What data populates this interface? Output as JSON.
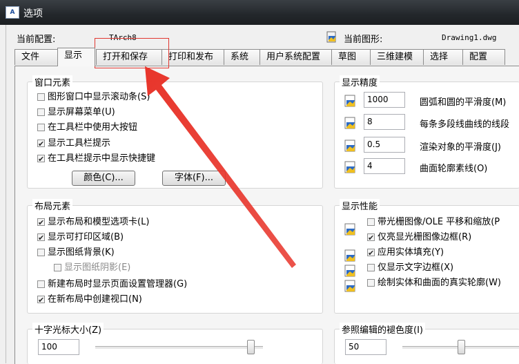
{
  "window": {
    "title": "选项",
    "app_icon_text": "A"
  },
  "profile": {
    "current_config_label": "当前配置:",
    "current_config_value": "TArch8",
    "current_drawing_label": "当前图形:",
    "current_drawing_value": "Drawing1.dwg"
  },
  "tabs": [
    {
      "label": "文件"
    },
    {
      "label": "显示"
    },
    {
      "label": "打开和保存"
    },
    {
      "label": "打印和发布"
    },
    {
      "label": "系统"
    },
    {
      "label": "用户系统配置"
    },
    {
      "label": "草图"
    },
    {
      "label": "三维建模"
    },
    {
      "label": "选择"
    },
    {
      "label": "配置"
    }
  ],
  "window_elements": {
    "title": "窗口元素",
    "checkboxes": [
      {
        "label": "图形窗口中显示滚动条(S)",
        "checked": false
      },
      {
        "label": "显示屏幕菜单(U)",
        "checked": false
      },
      {
        "label": "在工具栏中使用大按钮",
        "checked": false
      },
      {
        "label": "显示工具栏提示",
        "checked": true
      },
      {
        "label": "在工具栏提示中显示快捷键",
        "checked": true
      }
    ],
    "colors_button": "颜色(C)...",
    "fonts_button": "字体(F)..."
  },
  "layout_elements": {
    "title": "布局元素",
    "checkboxes": [
      {
        "label": "显示布局和模型选项卡(L)",
        "checked": true
      },
      {
        "label": "显示可打印区域(B)",
        "checked": true
      },
      {
        "label": "显示图纸背景(K)",
        "checked": false
      },
      {
        "label": "显示图纸阴影(E)",
        "checked": false
      },
      {
        "label": "新建布局时显示页面设置管理器(G)",
        "checked": false
      },
      {
        "label": "在新布局中创建视口(N)",
        "checked": true
      }
    ]
  },
  "crosshair": {
    "title": "十字光标大小(Z)",
    "value": "100",
    "slider_fraction": 0.95
  },
  "display_resolution": {
    "title": "显示精度",
    "rows": [
      {
        "value": "1000",
        "label": "圆弧和圆的平滑度(M)"
      },
      {
        "value": "8",
        "label": "每条多段线曲线的线段"
      },
      {
        "value": "0.5",
        "label": "渲染对象的平滑度(J)"
      },
      {
        "value": "4",
        "label": "曲面轮廓素线(O)"
      }
    ]
  },
  "display_performance": {
    "title": "显示性能",
    "checkboxes": [
      {
        "label": "带光栅图像/OLE 平移和缩放(P",
        "checked": false
      },
      {
        "label": "仅亮显光栅图像边框(R)",
        "checked": true
      },
      {
        "label": "应用实体填充(Y)",
        "checked": true
      },
      {
        "label": "仅显示文字边框(X)",
        "checked": false
      },
      {
        "label": "绘制实体和曲面的真实轮廓(W)",
        "checked": false
      }
    ]
  },
  "xref_fade": {
    "title": "参照编辑的褪色度(I)",
    "value": "50",
    "slider_fraction": 0.5
  },
  "colors": {
    "annotation_red": "#e0362f",
    "titlebar": "#23272b"
  }
}
